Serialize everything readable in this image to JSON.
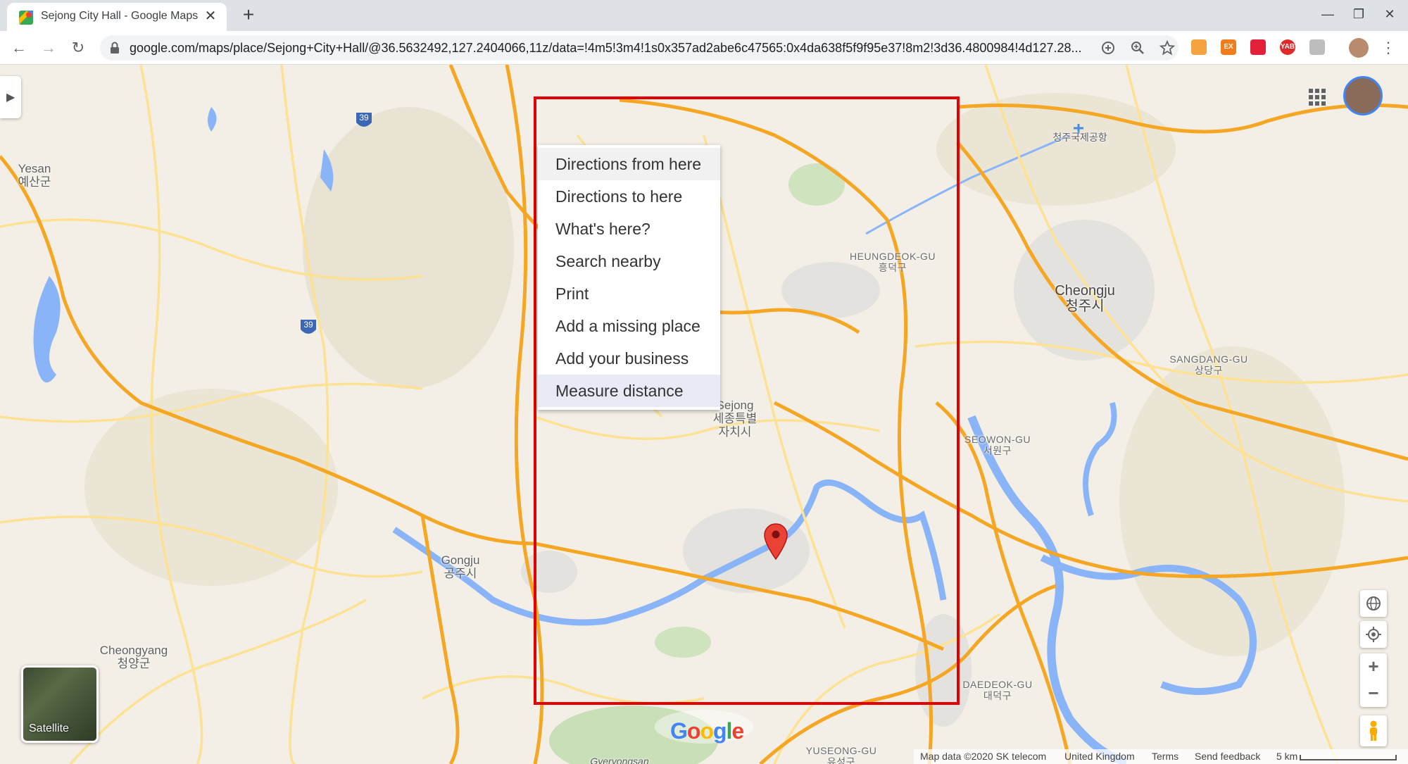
{
  "browser": {
    "tab": {
      "title": "Sejong City Hall - Google Maps",
      "close": "✕"
    },
    "new_tab": "+",
    "window_controls": {
      "minimize": "—",
      "restore": "❐",
      "close": "✕"
    },
    "nav": {
      "back": "←",
      "forward": "→",
      "reload": "↻"
    },
    "url": "google.com/maps/place/Sejong+City+Hall/@36.5632492,127.2404066,11z/data=!4m5!3m4!1s0x357ad2abe6c47565:0x4da638f5f9f95e37!8m2!3d36.4800984!4d127.28...",
    "extensions": [
      {
        "name": "ext-1",
        "label": "",
        "color": "#f4a340"
      },
      {
        "name": "ext-2",
        "label": "EX",
        "color": "#f07c1e"
      },
      {
        "name": "ext-3",
        "label": "",
        "color": "#e2203a"
      },
      {
        "name": "ext-4",
        "label": "YAB",
        "color": "#e02a2a"
      },
      {
        "name": "ext-5",
        "label": "",
        "color": "#bdbdbd"
      }
    ]
  },
  "map": {
    "context_menu": [
      "Directions from here",
      "Directions to here",
      "What's here?",
      "Search nearby",
      "Print",
      "Add a missing place",
      "Add your business",
      "Measure distance"
    ],
    "labels": {
      "yesan": "Yesan\n예산군",
      "cheongju": "Cheongju\n청주시",
      "heungdeok": "HEUNGDEOK-GU\n흥덕구",
      "sangdang": "SANGDANG-GU\n상당구",
      "seowon": "SEOWON-GU\n서원구",
      "sejong": "Sejong\n세종특별\n자치시",
      "gongju": "Gongju\n공주시",
      "cheongyang": "Cheongyang\n청양군",
      "daedeok": "DAEDEOK-GU\n대덕구",
      "yuseong": "YUSEONG-GU\n유성구",
      "gyeryongsan": "Gyeryongsan",
      "airport": "청주국제공항",
      "route_39_a": "39",
      "route_39_b": "39"
    },
    "satellite_label": "Satellite",
    "footer": {
      "map_data": "Map data ©2020 SK telecom",
      "region": "United Kingdom",
      "terms": "Terms",
      "feedback": "Send feedback",
      "scale": "5 km"
    }
  },
  "colors": {
    "selection_rect": "#e30000",
    "pin": "#ea4335",
    "road_major": "#f5a623",
    "road_minor": "#fde293",
    "water": "#8ab4f8"
  }
}
